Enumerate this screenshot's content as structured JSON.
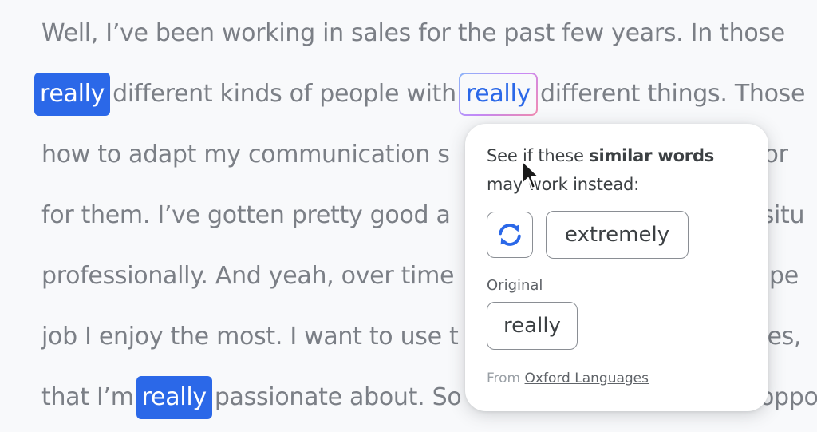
{
  "document": {
    "line1": "Well, I’ve been working in sales for the past few years. In those",
    "line2_a": "really",
    "line2_b": "different kinds of people with",
    "line2_c": "really",
    "line2_d": "different things. Those",
    "line3_a": "how to adapt my communication s",
    "line3_b": "oppor",
    "line4_a": "for them. I’ve gotten pretty good a",
    "line4_b": "y situ",
    "line5_a": "professionally. And yeah, over time",
    "line5_b": "g pe",
    "line6_a": "job I enjoy the most. I want to use t",
    "line6_b": "sales,",
    "line7_a": "that I’m",
    "line7_b": "really",
    "line7_c": "passionate about. So",
    "line7_d": "g oppo"
  },
  "popup": {
    "title_prefix": "See if these ",
    "title_bold": "similar words",
    "title_suffix": " may work instead:",
    "suggestion": "extremely",
    "original_label": "Original",
    "original_word": "really",
    "from_prefix": "From ",
    "from_link": "Oxford Languages"
  },
  "colors": {
    "highlight": "#2b68e8",
    "text": "#7b7f86"
  },
  "icons": {
    "refresh": "refresh-icon",
    "cursor": "mouse-cursor-icon"
  }
}
